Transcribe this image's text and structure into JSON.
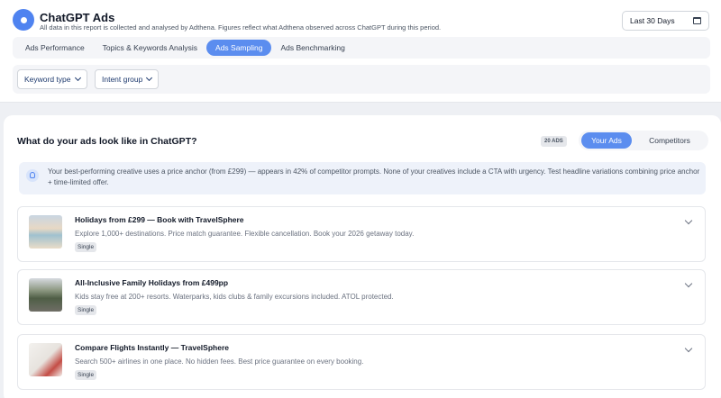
{
  "header": {
    "title": "ChatGPT Ads",
    "subtitle": "All data in this report is collected and analysed by Adthena. Figures reflect what Adthena observed across ChatGPT during this period.",
    "date_range": "Last 30 Days"
  },
  "tabs": [
    {
      "label": "Ads Performance",
      "active": false
    },
    {
      "label": "Topics & Keywords Analysis",
      "active": false
    },
    {
      "label": "Ads Sampling",
      "active": true
    },
    {
      "label": "Ads Benchmarking",
      "active": false
    }
  ],
  "filters": {
    "keyword_type": "Keyword type",
    "intent_group": "Intent group"
  },
  "main": {
    "title": "What do your ads look like in ChatGPT?",
    "count": "20 ADS",
    "toggle": {
      "yours": "Your Ads",
      "competitors": "Competitors",
      "selected": "yours"
    },
    "insight": "Your best-performing creative uses a price anchor (from £299) — appears in 42% of competitor prompts. None of your creatives include a CTA with urgency. Test headline variations combining price anchor + time-limited offer.",
    "ads": [
      {
        "title": "Holidays from £299 — Book with TravelSphere",
        "description": "Explore 1,000+ destinations. Price match guarantee. Flexible cancellation. Book your 2026 getaway today.",
        "format": "Single"
      },
      {
        "title": "All-Inclusive Family Holidays from £499pp",
        "description": "Kids stay free at 200+ resorts. Waterparks, kids clubs & family excursions included. ATOL protected.",
        "format": "Single"
      },
      {
        "title": "Compare Flights Instantly — TravelSphere",
        "description": "Search 500+ airlines in one place. No hidden fees. Best price guarantee on every booking.",
        "format": "Single"
      }
    ]
  },
  "colors": {
    "accent": "#5b8def",
    "brand": "#4f83f0"
  }
}
